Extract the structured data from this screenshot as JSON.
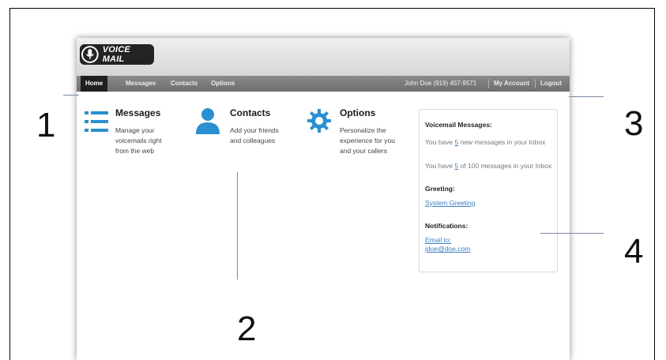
{
  "app": {
    "logo_text": "VOICE MAIL"
  },
  "nav": {
    "home": "Home",
    "messages": "Messages",
    "contacts": "Contacts",
    "options": "Options",
    "user_info": "John Doe (919) 457-9571",
    "my_account": "My Account",
    "logout": "Logout"
  },
  "features": {
    "messages": {
      "title": "Messages",
      "desc_lines": [
        "Manage your",
        "voicemails right",
        "from the web"
      ]
    },
    "contacts": {
      "title": "Contacts",
      "desc_lines": [
        "Add your friends",
        "and colleagues"
      ]
    },
    "options": {
      "title": "Options",
      "desc_lines": [
        "Personalize the",
        "experience for you",
        "and your callers"
      ]
    }
  },
  "sidebar": {
    "voicemail_heading": "Voicemail Messages:",
    "new_prefix": "You have ",
    "new_count": "5",
    "new_suffix": " new messages in your Inbox",
    "total_prefix": "You have ",
    "total_count": "5",
    "total_suffix": " of 100 messages in your Inbox",
    "greeting_heading": "Greeting:",
    "greeting_link": "System Greeting",
    "notifications_heading": "Notifications:",
    "email_line1": "Email to:",
    "email_line2": "jdoe@doe.com"
  },
  "callouts": {
    "one": "1",
    "two": "2",
    "three": "3",
    "four": "4"
  },
  "colors": {
    "accent_blue": "#2a8fd0",
    "link_blue": "#3a7fc2",
    "nav_gray": "#7a7a7a",
    "home_tab": "#1f1f1f"
  }
}
